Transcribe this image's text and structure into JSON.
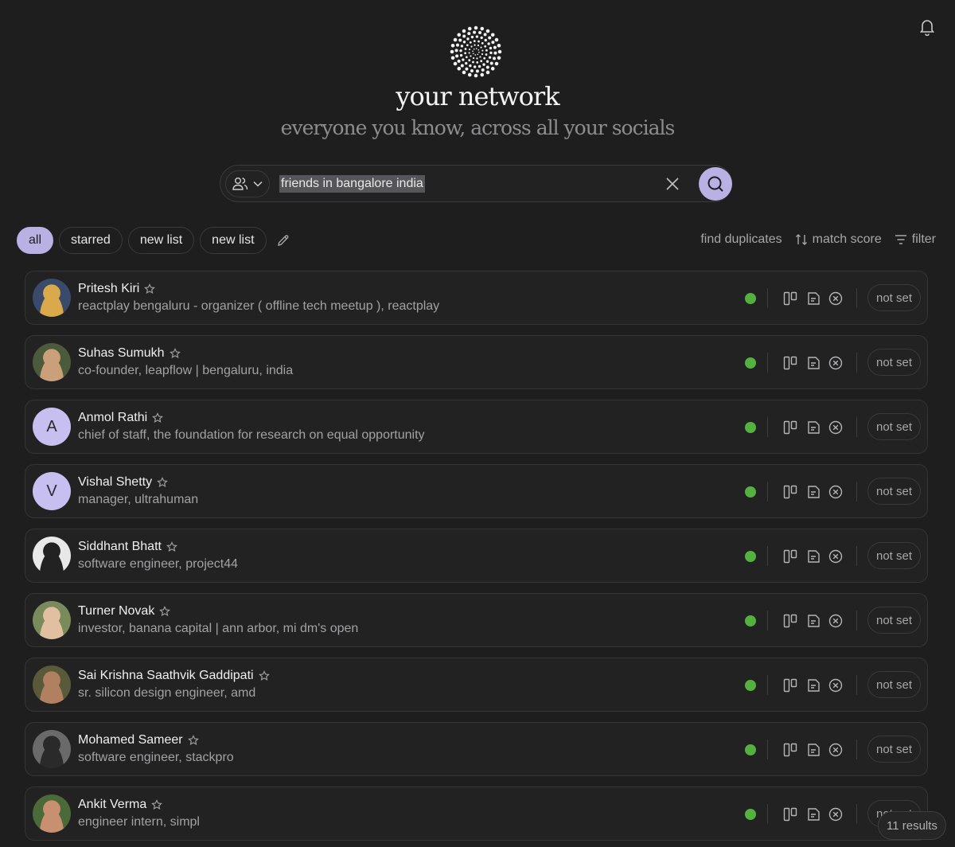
{
  "header": {
    "title": "your network",
    "subtitle": "everyone you know, across all your socials"
  },
  "search": {
    "query": "friends in bangalore india"
  },
  "tabs": [
    {
      "label": "all"
    },
    {
      "label": "starred"
    },
    {
      "label": "new list"
    },
    {
      "label": "new list"
    }
  ],
  "toolbar": {
    "find_duplicates": "find duplicates",
    "match_score": "match score",
    "filter": "filter"
  },
  "contacts": [
    {
      "name": "Pritesh Kiri",
      "description": "reactplay bengaluru - organizer ( offline tech meetup ), reactplay",
      "avatar": "photo",
      "status": "not set"
    },
    {
      "name": "Suhas Sumukh",
      "description": "co-founder, leapflow  |  bengaluru, india",
      "avatar": "photo",
      "status": "not set"
    },
    {
      "name": "Anmol Rathi",
      "description": "chief of staff, the foundation for research on equal opportunity",
      "avatar": "A",
      "status": "not set"
    },
    {
      "name": "Vishal Shetty",
      "description": "manager, ultrahuman",
      "avatar": "V",
      "status": "not set"
    },
    {
      "name": "Siddhant Bhatt",
      "description": "software engineer, project44",
      "avatar": "photo",
      "status": "not set"
    },
    {
      "name": "Turner Novak",
      "description": "investor, banana capital  |  ann arbor, mi   dm's open",
      "avatar": "photo",
      "status": "not set"
    },
    {
      "name": "Sai Krishna Saathvik Gaddipati",
      "description": "sr. silicon design engineer, amd",
      "avatar": "photo",
      "status": "not set"
    },
    {
      "name": "Mohamed Sameer",
      "description": "software engineer, stackpro",
      "avatar": "photo",
      "status": "not set"
    },
    {
      "name": "Ankit Verma",
      "description": "engineer intern, simpl",
      "avatar": "photo",
      "status": "not set"
    }
  ],
  "footer": {
    "results": "11 results"
  },
  "colors": {
    "accent": "#b9b0e3",
    "online": "#55b13f",
    "background": "#1e1e1f"
  }
}
